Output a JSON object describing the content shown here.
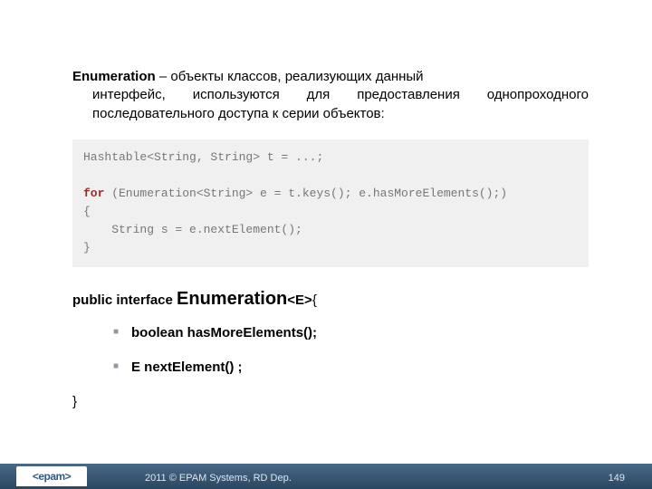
{
  "description": {
    "lead": "Enumeration",
    "sep": " – ",
    "rest_line1": "объекты классов, реализующих данный",
    "rest_line2": "интерфейс, используются для предоставления однопроходного последовательного доступа к серии объектов:"
  },
  "code": {
    "line1": "Hashtable<String, String> t = ...;",
    "line2_kw": "for",
    "line2_rest": " (Enumeration<String> e = t.keys(); e.hasMoreElements();)",
    "line3": "{",
    "line4": "    String s = e.nextElement();",
    "line5": "}"
  },
  "interface": {
    "prefix": "public interface ",
    "name": "Enumeration",
    "generic": "<E>",
    "open": "{",
    "methods": [
      "boolean hasMoreElements();",
      "E nextElement() ;"
    ],
    "close": "}"
  },
  "footer": {
    "logo": "<epam>",
    "copyright": "2011 © EPAM Systems, RD Dep.",
    "page": "149"
  }
}
